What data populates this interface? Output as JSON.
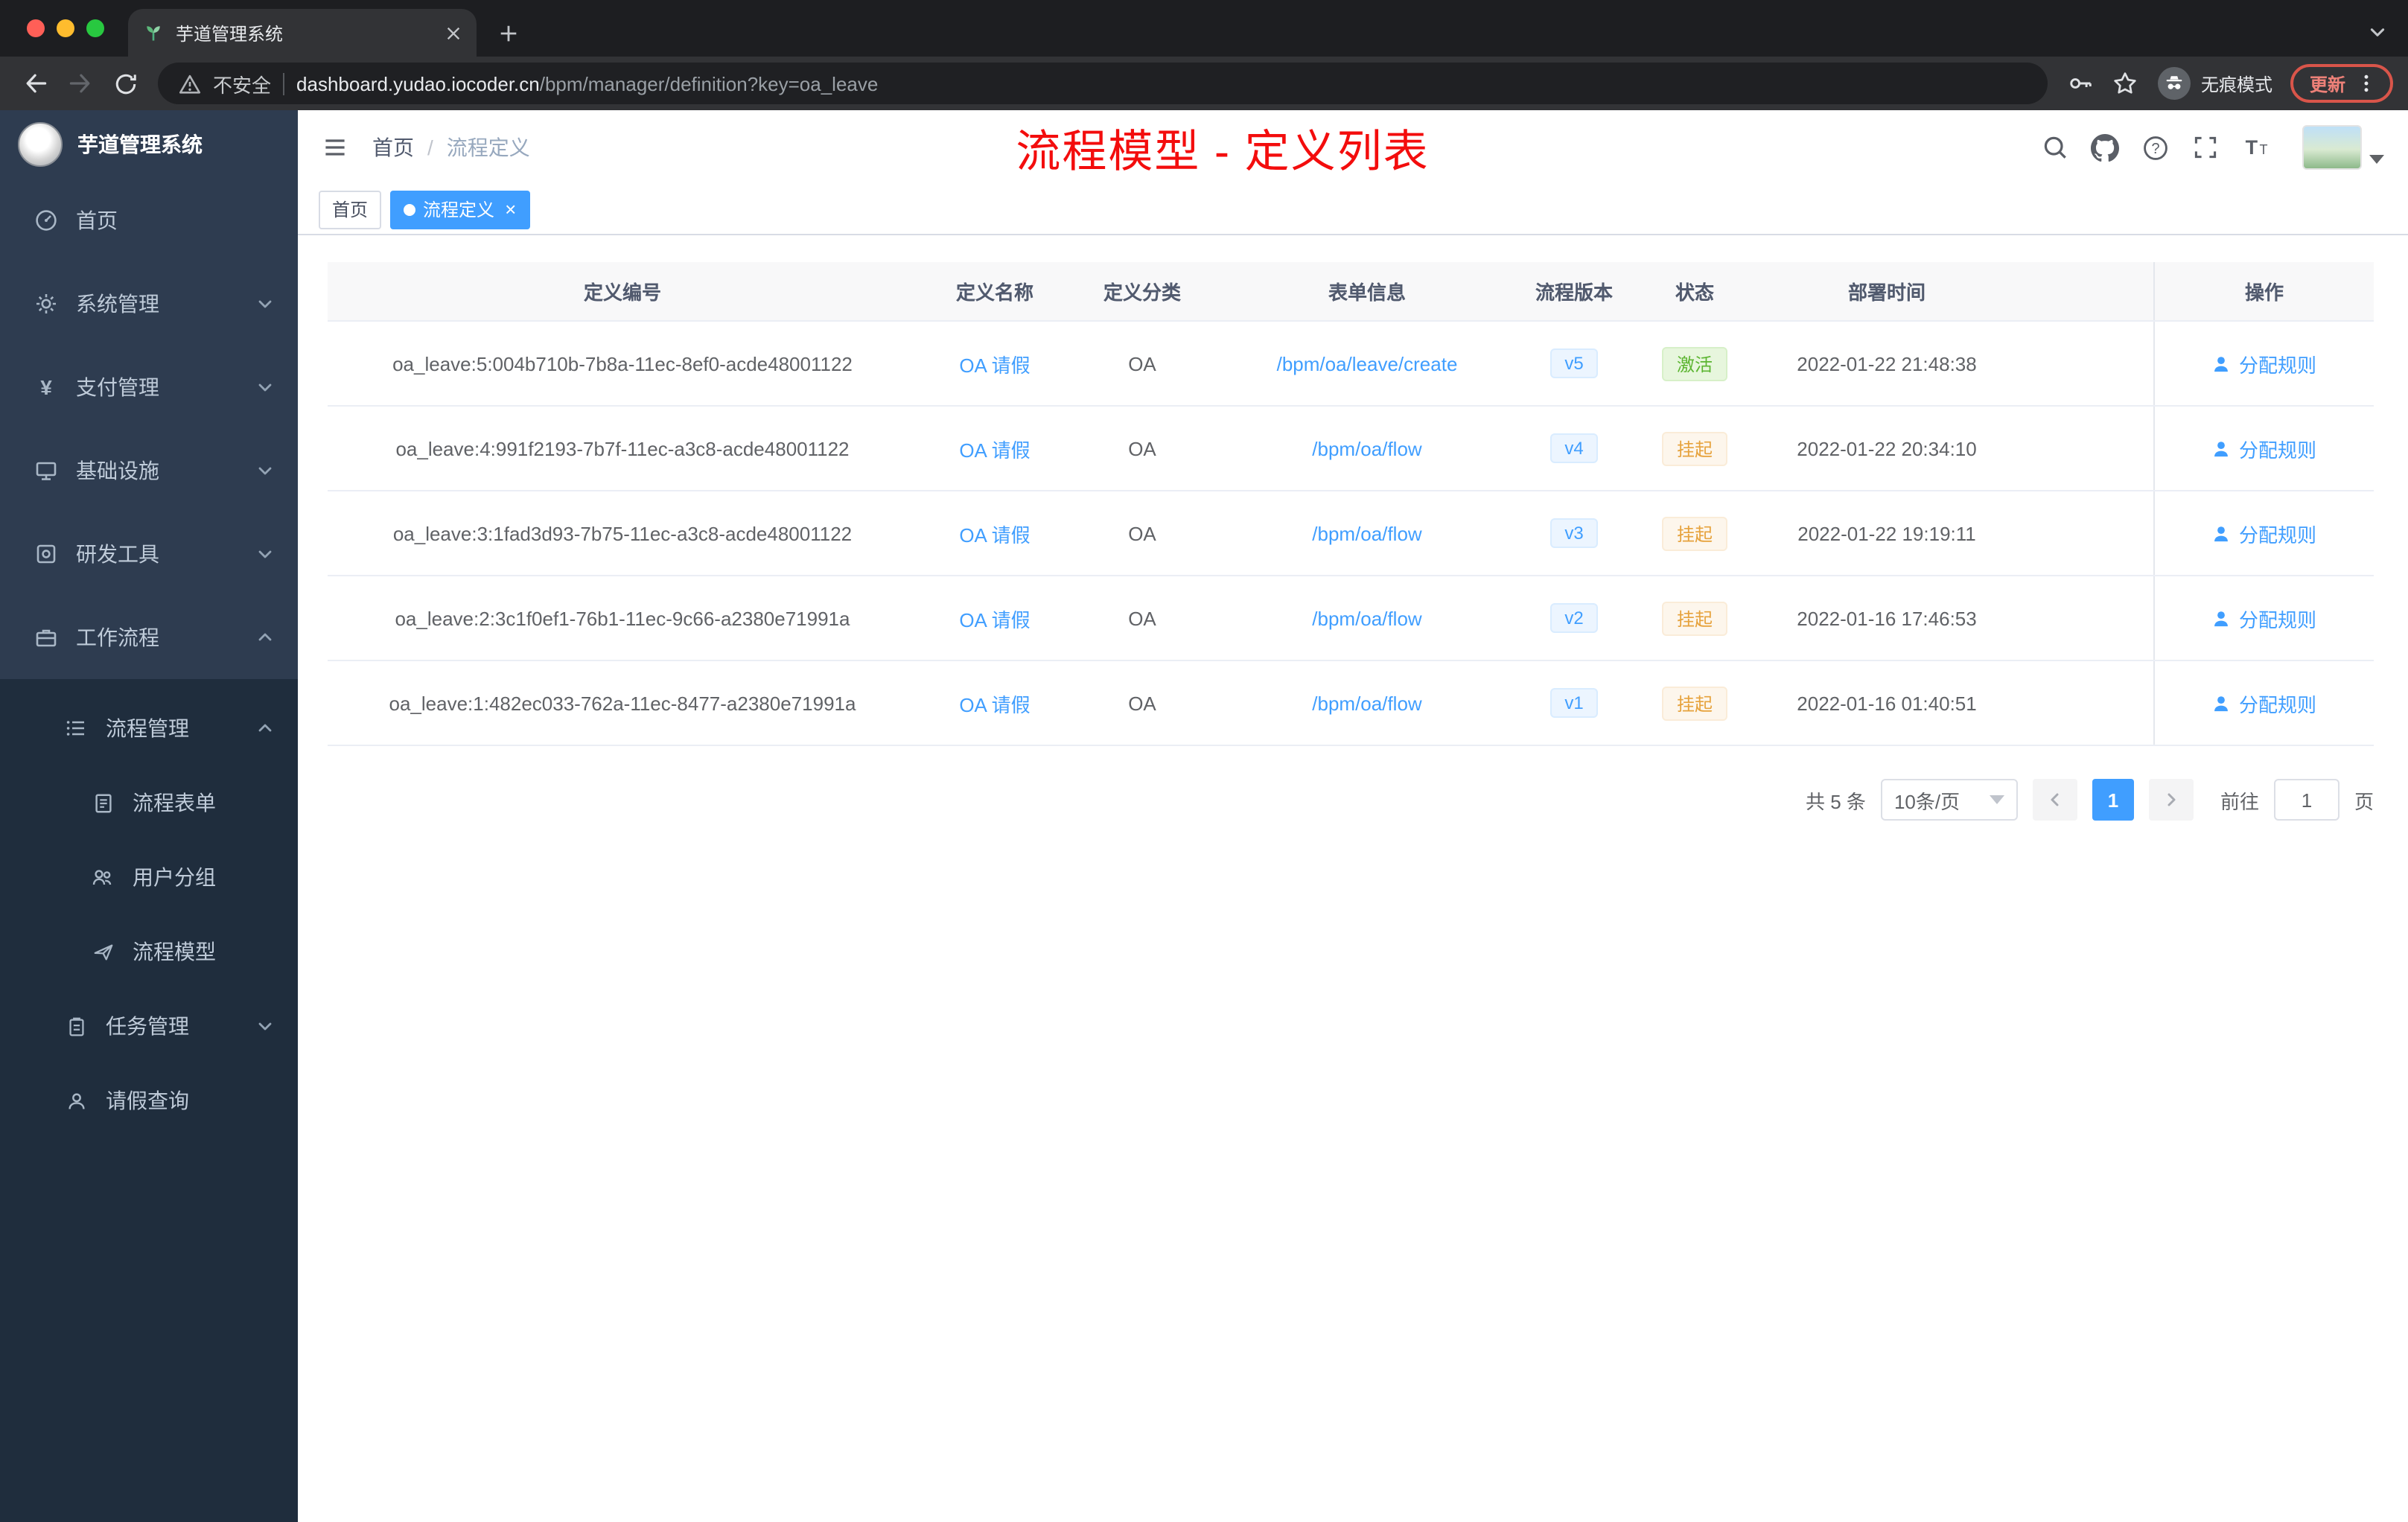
{
  "colors": {
    "accent": "#409eff",
    "success": "#67c23a",
    "warning": "#e6a23c",
    "annotation_red": "#f30d0d",
    "sidebar_bg": "#2e3c50",
    "submenu_bg": "#1f2d3d"
  },
  "browser": {
    "tab_title": "芋道管理系统",
    "security_label": "不安全",
    "url_domain": "dashboard.yudao.iocoder.cn",
    "url_path": "/bpm/manager/definition?key=oa_leave",
    "incognito_label": "无痕模式",
    "update_label": "更新"
  },
  "sidebar": {
    "logo_title": "芋道管理系统",
    "items": [
      {
        "label": "首页"
      },
      {
        "label": "系统管理"
      },
      {
        "label": "支付管理"
      },
      {
        "label": "基础设施"
      },
      {
        "label": "研发工具"
      },
      {
        "label": "工作流程"
      }
    ],
    "submenu": {
      "label": "流程管理",
      "children": [
        {
          "label": "流程表单"
        },
        {
          "label": "用户分组"
        },
        {
          "label": "流程模型"
        }
      ]
    },
    "task_item": "任务管理",
    "leave_item": "请假查询"
  },
  "header": {
    "breadcrumb_home": "首页",
    "breadcrumb_separator": "/",
    "breadcrumb_current": "流程定义",
    "annotation": "流程模型 - 定义列表"
  },
  "tags": {
    "home": "首页",
    "active": "流程定义"
  },
  "table": {
    "columns": [
      "定义编号",
      "定义名称",
      "定义分类",
      "表单信息",
      "流程版本",
      "状态",
      "部署时间",
      "操作"
    ],
    "rows": [
      {
        "id": "oa_leave:5:004b710b-7b8a-11ec-8ef0-acde48001122",
        "name": "OA 请假",
        "category": "OA",
        "form": "/bpm/oa/leave/create",
        "version": "v5",
        "status": "激活",
        "status_type": "success",
        "time": "2022-01-22 21:48:38",
        "action": "分配规则"
      },
      {
        "id": "oa_leave:4:991f2193-7b7f-11ec-a3c8-acde48001122",
        "name": "OA 请假",
        "category": "OA",
        "form": "/bpm/oa/flow",
        "version": "v4",
        "status": "挂起",
        "status_type": "warning",
        "time": "2022-01-22 20:34:10",
        "action": "分配规则"
      },
      {
        "id": "oa_leave:3:1fad3d93-7b75-11ec-a3c8-acde48001122",
        "name": "OA 请假",
        "category": "OA",
        "form": "/bpm/oa/flow",
        "version": "v3",
        "status": "挂起",
        "status_type": "warning",
        "time": "2022-01-22 19:19:11",
        "action": "分配规则"
      },
      {
        "id": "oa_leave:2:3c1f0ef1-76b1-11ec-9c66-a2380e71991a",
        "name": "OA 请假",
        "category": "OA",
        "form": "/bpm/oa/flow",
        "version": "v2",
        "status": "挂起",
        "status_type": "warning",
        "time": "2022-01-16 17:46:53",
        "action": "分配规则"
      },
      {
        "id": "oa_leave:1:482ec033-762a-11ec-8477-a2380e71991a",
        "name": "OA 请假",
        "category": "OA",
        "form": "/bpm/oa/flow",
        "version": "v1",
        "status": "挂起",
        "status_type": "warning",
        "time": "2022-01-16 01:40:51",
        "action": "分配规则"
      }
    ]
  },
  "pagination": {
    "total": "共 5 条",
    "page_size": "10条/页",
    "current_page": "1",
    "goto_label": "前往",
    "goto_value": "1",
    "page_unit": "页"
  }
}
